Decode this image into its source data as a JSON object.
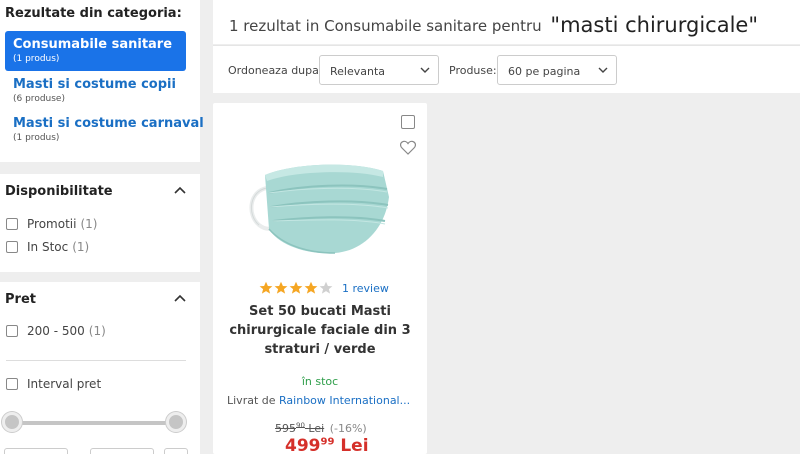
{
  "sidebar": {
    "categories_title": "Rezultate din categoria:",
    "categories": [
      {
        "name": "Consumabile sanitare",
        "count": "(1 produs)",
        "active": true
      },
      {
        "name": "Masti si costume copii",
        "count": "(6 produse)",
        "active": false
      },
      {
        "name": "Masti si costume carnaval",
        "count": "(1 produs)",
        "active": false
      }
    ],
    "availability": {
      "title": "Disponibilitate",
      "options": [
        {
          "label": "Promotii",
          "count": "(1)"
        },
        {
          "label": "In Stoc",
          "count": "(1)"
        }
      ]
    },
    "price": {
      "title": "Pret",
      "range_option": {
        "label": "200 - 500",
        "count": "(1)"
      },
      "interval_label": "Interval pret"
    }
  },
  "header": {
    "result_text": "1 rezultat in Consumabile sanitare  pentru",
    "query": "\"masti chirurgicale\""
  },
  "sort": {
    "order_label": "Ordoneaza dupa:",
    "order_value": "Relevanta",
    "products_label": "Produse:",
    "products_value": "60 pe pagina"
  },
  "product": {
    "rating_stars": 4,
    "reviews": "1 review",
    "title": "Set 50 bucati Masti chirurgicale faciale din 3 straturi / verde",
    "stock": "în stoc",
    "seller_prefix": "Livrat de",
    "seller": "Rainbow International...",
    "old_price": "595",
    "old_price_decimals": "90",
    "old_price_currency": "Lei",
    "discount": "(-16%)",
    "price": "499",
    "price_decimals": "99",
    "currency": "Lei"
  },
  "colors": {
    "accent": "#1a73e8",
    "link": "#1a6fc4",
    "price": "#d5302a",
    "stock": "#2e9e4a",
    "star": "#f5a623"
  }
}
